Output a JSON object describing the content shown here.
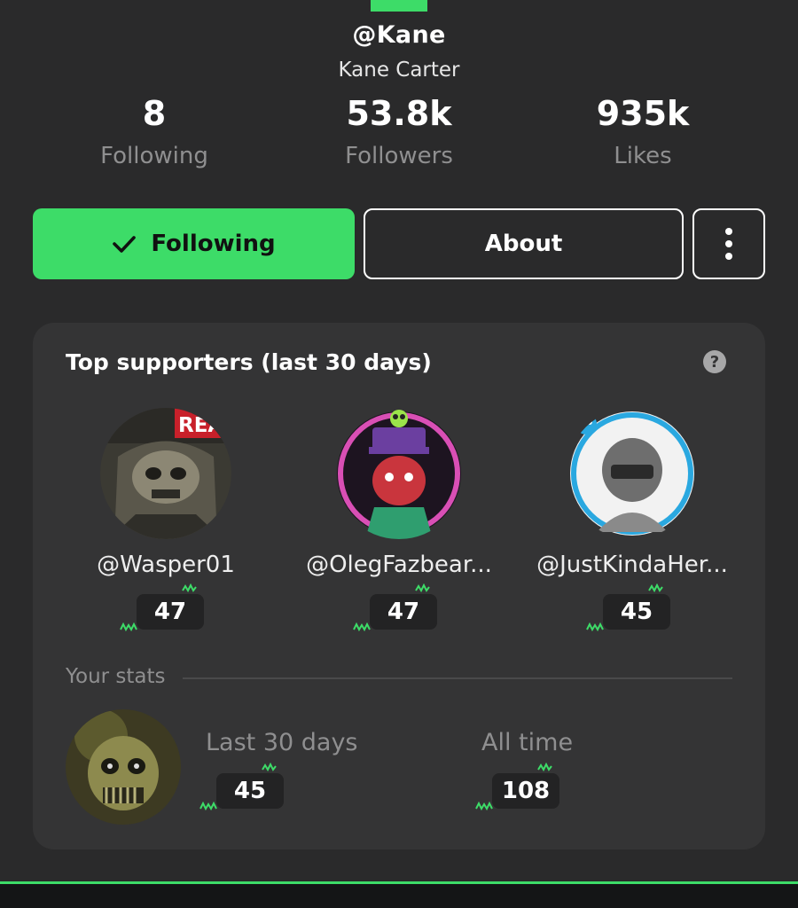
{
  "profile": {
    "handle": "@Kane",
    "display_name": "Kane Carter"
  },
  "stats": [
    {
      "value": "8",
      "label": "Following"
    },
    {
      "value": "53.8k",
      "label": "Followers"
    },
    {
      "value": "935k",
      "label": "Likes"
    }
  ],
  "actions": {
    "following_label": "Following",
    "about_label": "About",
    "more_icon": "more-vertical-icon",
    "check_icon": "check-icon"
  },
  "supporters_card": {
    "title": "Top supporters (last 30 days)",
    "help_icon": "question-mark-icon",
    "help_glyph": "?",
    "supporters": [
      {
        "username": "@Wasper01",
        "count": "47",
        "avatar_overlay_text": "REA"
      },
      {
        "username": "@OlegFazbear...",
        "count": "47"
      },
      {
        "username": "@JustKindaHer...",
        "count": "45"
      }
    ],
    "your_stats": {
      "heading": "Your stats",
      "last_30_days_label": "Last 30 days",
      "last_30_days_value": "45",
      "all_time_label": "All time",
      "all_time_value": "108"
    }
  },
  "colors": {
    "accent_green": "#3ddc68",
    "background": "#2a2a2b",
    "card": "#343435",
    "muted_text": "#8f8f90"
  }
}
